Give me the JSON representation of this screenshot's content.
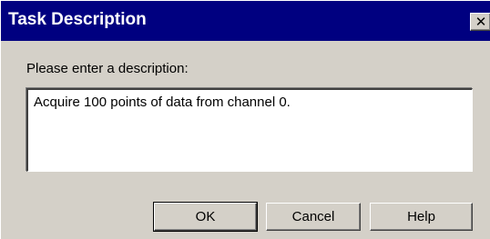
{
  "dialog": {
    "title": "Task Description",
    "close_glyph": "✕",
    "close_icon": "close-icon",
    "prompt": "Please enter a description:",
    "description_value": "Acquire 100 points of data from channel 0.",
    "buttons": {
      "ok": "OK",
      "cancel": "Cancel",
      "help": "Help"
    }
  },
  "colors": {
    "titlebar": "#000080",
    "window_face": "#d4d0c8",
    "field_background": "#ffffff"
  }
}
